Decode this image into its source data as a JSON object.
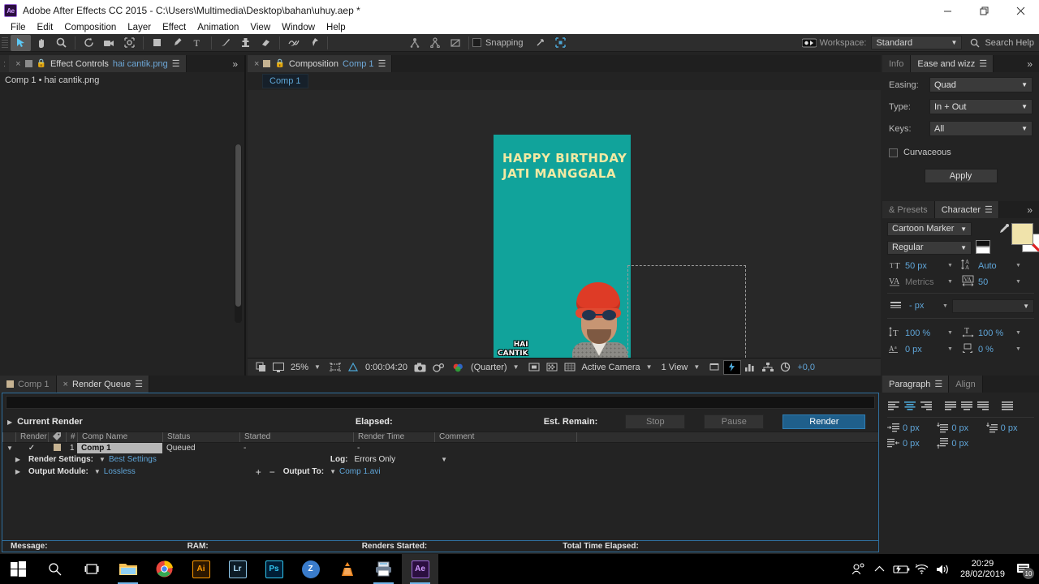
{
  "window": {
    "title": "Adobe After Effects CC 2015 - C:\\Users\\Multimedia\\Desktop\\bahan\\uhuy.aep *",
    "app_badge": "Ae",
    "minimize": "minimize-icon",
    "maximize": "restore-icon",
    "close": "close-icon"
  },
  "menu": [
    "File",
    "Edit",
    "Composition",
    "Layer",
    "Effect",
    "Animation",
    "View",
    "Window",
    "Help"
  ],
  "toolbar": {
    "snapping_label": "Snapping",
    "workspace_label": "Workspace:",
    "workspace_value": "Standard",
    "search_placeholder": "Search Help",
    "tools": [
      "selection-tool",
      "hand-tool",
      "zoom-tool",
      "rotation-tool",
      "camera-tool",
      "pan-behind-tool",
      "shape-tool",
      "pen-tool",
      "type-tool",
      "brush-tool",
      "clone-stamp-tool",
      "eraser-tool",
      "roto-brush-tool",
      "puppet-pin-tool"
    ]
  },
  "effect_controls": {
    "tab_label": "Effect Controls",
    "tab_item": "hai cantik.png",
    "subtitle": "Comp 1 • hai cantik.png",
    "left_tab": ":"
  },
  "composition": {
    "tab_label": "Composition",
    "tab_item": "Comp 1",
    "chip": "Comp 1",
    "artwork": {
      "line1": "HAPPY BIRTHDAY",
      "line2": "JATI MANGGALA",
      "sticker_line1": "HAI",
      "sticker_line2": "CANTIK",
      "bg_color": "#11a39b",
      "text_color": "#f2e9a3",
      "beanie_color": "#de3b26"
    },
    "toolbar": {
      "zoom": "25%",
      "timecode": "0:00:04:20",
      "resolution": "(Quarter)",
      "view_camera": "Active Camera",
      "view_count": "1 View",
      "exposure": "+0,0"
    }
  },
  "ease_wizz": {
    "tab_info": "Info",
    "tab_active": "Ease and wizz",
    "rows": [
      {
        "label": "Easing:",
        "value": "Quad"
      },
      {
        "label": "Type:",
        "value": "In + Out"
      },
      {
        "label": "Keys:",
        "value": "All"
      }
    ],
    "checkbox_label": "Curvaceous",
    "apply_label": "Apply"
  },
  "character": {
    "tab_presets": "& Presets",
    "tab_active": "Character",
    "font_family": "Cartoon Marker",
    "font_style": "Regular",
    "font_size": "50 px",
    "leading": "Auto",
    "kerning": "Metrics",
    "tracking": "50",
    "stroke_width": "- px",
    "vertical_scale": "100 %",
    "horizontal_scale": "100 %",
    "baseline_shift": "0 px",
    "tsume": "0 %",
    "fill_color": "#f0e3ab"
  },
  "paragraph": {
    "tab_active": "Paragraph",
    "tab_align": "Align",
    "indent_left": "0 px",
    "indent_right": "0 px",
    "indent_first": "0 px",
    "space_before": "0 px",
    "space_after": "0 px",
    "align_icons": [
      "align-left-icon",
      "align-center-icon",
      "align-right-icon",
      "justify-last-left-icon",
      "justify-last-center-icon",
      "justify-last-right-icon",
      "justify-all-icon"
    ]
  },
  "render_queue": {
    "tab_comp": "Comp 1",
    "tab_active": "Render Queue",
    "current_render": "Current Render",
    "elapsed_label": "Elapsed:",
    "est_remain_label": "Est. Remain:",
    "buttons": {
      "stop": "Stop",
      "pause": "Pause",
      "render": "Render"
    },
    "columns": [
      "Render",
      "tag",
      "#",
      "Comp Name",
      "Status",
      "Started",
      "Render Time",
      "Comment"
    ],
    "row": {
      "index": "1",
      "comp_name": "Comp 1",
      "status": "Queued",
      "started": "-",
      "render_time": "-",
      "comment": ""
    },
    "render_settings_label": "Render Settings:",
    "render_settings_value": "Best Settings",
    "log_label": "Log:",
    "log_value": "Errors Only",
    "output_module_label": "Output Module:",
    "output_module_value": "Lossless",
    "output_to_label": "Output To:",
    "output_to_value": "Comp 1.avi",
    "footer": {
      "message": "Message:",
      "ram": "RAM:",
      "renders_started": "Renders Started:",
      "total_time": "Total Time Elapsed:"
    }
  },
  "taskbar": {
    "items": [
      {
        "name": "start-button",
        "glyph": "⊞",
        "color": "#ffffff",
        "bg": "transparent"
      },
      {
        "name": "search-icon",
        "glyph": "⚲",
        "color": "#ffffff",
        "bg": "transparent"
      },
      {
        "name": "task-view-icon",
        "glyph": "⧉",
        "color": "#ffffff",
        "bg": "transparent"
      },
      {
        "name": "file-explorer-icon",
        "glyph": "Ὄ1",
        "color": "#ffc75a",
        "bg": "transparent"
      },
      {
        "name": "google-chrome-icon",
        "glyph": "",
        "color": "#ffffff",
        "bg": "transparent"
      },
      {
        "name": "adobe-illustrator-icon",
        "glyph": "Ai",
        "color": "#ff9a00",
        "bg": "#2b1700"
      },
      {
        "name": "adobe-lightroom-icon",
        "glyph": "Lr",
        "color": "#addbf7",
        "bg": "#0c1b26"
      },
      {
        "name": "adobe-photoshop-icon",
        "glyph": "Ps",
        "color": "#31c5f0",
        "bg": "#001e36"
      },
      {
        "name": "zotero-icon",
        "glyph": "Z",
        "color": "#ffffff",
        "bg": "#3a7ccc"
      },
      {
        "name": "vlc-media-player-icon",
        "glyph": "",
        "color": "#ff8800",
        "bg": "transparent"
      },
      {
        "name": "printer-icon",
        "glyph": "",
        "color": "#cfd8e3",
        "bg": "transparent"
      },
      {
        "name": "adobe-after-effects-icon",
        "glyph": "Ae",
        "color": "#cf9bff",
        "bg": "#2b0f3f"
      }
    ],
    "tray": {
      "people_icon": "people-icon",
      "chevron_up": "show-hidden-icons-icon",
      "battery": "battery-charging-icon",
      "wifi": "wifi-icon",
      "volume": "volume-icon",
      "time": "20:29",
      "date": "28/02/2019",
      "notification_count": "10"
    }
  }
}
